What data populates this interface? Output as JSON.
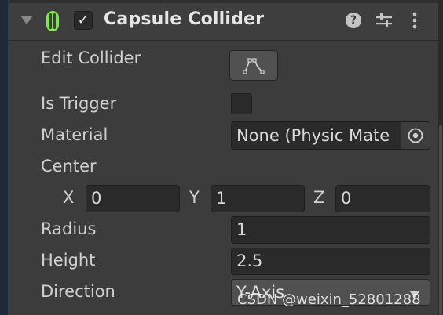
{
  "component": {
    "title": "Capsule Collider",
    "enabled_check": "✓",
    "help_glyph": "?"
  },
  "properties": {
    "edit_collider": {
      "label": "Edit Collider"
    },
    "is_trigger": {
      "label": "Is Trigger",
      "checked": false
    },
    "material": {
      "label": "Material",
      "value": "None (Physic Mate"
    },
    "center": {
      "label": "Center",
      "x_label": "X",
      "x_value": "0",
      "y_label": "Y",
      "y_value": "1",
      "z_label": "Z",
      "z_value": "0"
    },
    "radius": {
      "label": "Radius",
      "value": "1"
    },
    "height": {
      "label": "Height",
      "value": "2.5"
    },
    "direction": {
      "label": "Direction",
      "value": "Y-Axis"
    }
  },
  "watermark": "CSDN @weixin_52801288",
  "colors": {
    "capsule_icon": "#7ee84a",
    "panel": "#3c3c3c",
    "field": "#2a2a2a"
  }
}
